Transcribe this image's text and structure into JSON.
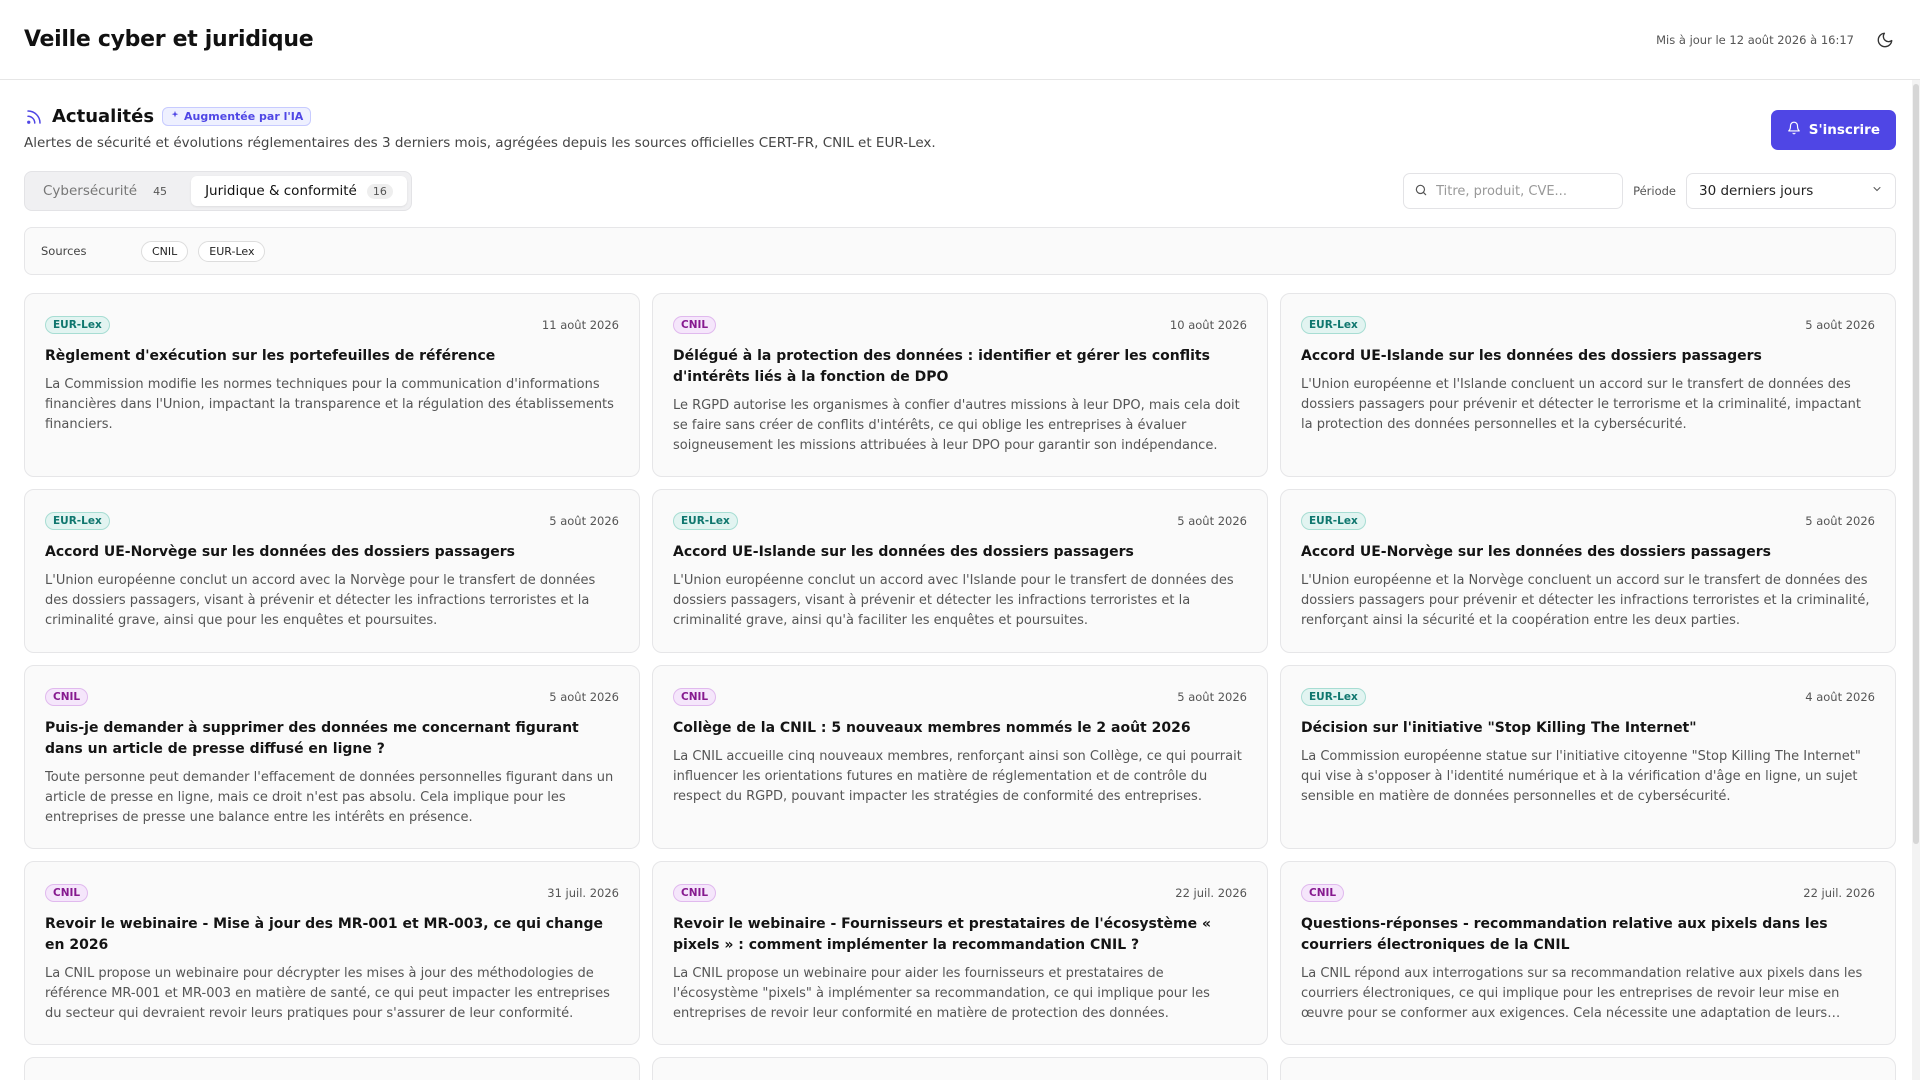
{
  "header": {
    "title": "Veille cyber et juridique",
    "updated": "Mis à jour le 12 août 2026 à 16:17",
    "theme_icon": "moon-icon"
  },
  "section": {
    "title": "Actualités",
    "ai_badge": "Augmentée par l'IA",
    "subtitle": "Alertes de sécurité et évolutions réglementaires des 3 derniers mois, agrégées depuis les sources officielles CERT-FR, CNIL et EUR-Lex.",
    "subscribe_label": "S'inscrire"
  },
  "tabs": [
    {
      "label": "Cybersécurité",
      "count": "45",
      "active": false
    },
    {
      "label": "Juridique & conformité",
      "count": "16",
      "active": true
    }
  ],
  "search": {
    "placeholder": "Titre, produit, CVE..."
  },
  "period": {
    "label": "Période",
    "value": "30 derniers jours"
  },
  "sources": {
    "label": "Sources",
    "chips": [
      "CNIL",
      "EUR-Lex"
    ]
  },
  "colors": {
    "accent": "#4f46e5",
    "eurlex": "#0f766e",
    "cnil": "#86198f"
  },
  "cards": [
    {
      "source": "EUR-Lex",
      "date": "11 août 2026",
      "title": "Règlement d'exécution sur les portefeuilles de référence",
      "text": "La Commission modifie les normes techniques pour la communication d'informations financières dans l'Union, impactant la transparence et la régulation des établissements financiers."
    },
    {
      "source": "CNIL",
      "date": "10 août 2026",
      "title": "Délégué à la protection des données : identifier et gérer les conflits d'intérêts liés à la fonction de DPO",
      "text": "Le RGPD autorise les organismes à confier d'autres missions à leur DPO, mais cela doit se faire sans créer de conflits d'intérêts, ce qui oblige les entreprises à évaluer soigneusement les missions attribuées à leur DPO pour garantir son indépendance."
    },
    {
      "source": "EUR-Lex",
      "date": "5 août 2026",
      "title": "Accord UE-Islande sur les données des dossiers passagers",
      "text": "L'Union européenne et l'Islande concluent un accord sur le transfert de données des dossiers passagers pour prévenir et détecter le terrorisme et la criminalité, impactant la protection des données personnelles et la cybersécurité."
    },
    {
      "source": "EUR-Lex",
      "date": "5 août 2026",
      "title": "Accord UE-Norvège sur les données des dossiers passagers",
      "text": "L'Union européenne conclut un accord avec la Norvège pour le transfert de données des dossiers passagers, visant à prévenir et détecter les infractions terroristes et la criminalité grave, ainsi que pour les enquêtes et poursuites."
    },
    {
      "source": "EUR-Lex",
      "date": "5 août 2026",
      "title": "Accord UE-Islande sur les données des dossiers passagers",
      "text": "L'Union européenne conclut un accord avec l'Islande pour le transfert de données des dossiers passagers, visant à prévenir et détecter les infractions terroristes et la criminalité grave, ainsi qu'à faciliter les enquêtes et poursuites."
    },
    {
      "source": "EUR-Lex",
      "date": "5 août 2026",
      "title": "Accord UE-Norvège sur les données des dossiers passagers",
      "text": "L'Union européenne et la Norvège concluent un accord sur le transfert de données des dossiers passagers pour prévenir et détecter les infractions terroristes et la criminalité, renforçant ainsi la sécurité et la coopération entre les deux parties."
    },
    {
      "source": "CNIL",
      "date": "5 août 2026",
      "title": "Puis-je demander à supprimer des données me concernant figurant dans un article de presse diffusé en ligne ?",
      "text": "Toute personne peut demander l'effacement de données personnelles figurant dans un article de presse en ligne, mais ce droit n'est pas absolu. Cela implique pour les entreprises de presse une balance entre les intérêts en présence."
    },
    {
      "source": "CNIL",
      "date": "5 août 2026",
      "title": "Collège de la CNIL : 5 nouveaux membres nommés le 2 août 2026",
      "text": "La CNIL accueille cinq nouveaux membres, renforçant ainsi son Collège, ce qui pourrait influencer les orientations futures en matière de réglementation et de contrôle du respect du RGPD, pouvant impacter les stratégies de conformité des entreprises."
    },
    {
      "source": "EUR-Lex",
      "date": "4 août 2026",
      "title": "Décision sur l'initiative \"Stop Killing The Internet\"",
      "text": "La Commission européenne statue sur l'initiative citoyenne \"Stop Killing The Internet\" qui vise à s'opposer à l'identité numérique et à la vérification d'âge en ligne, un sujet sensible en matière de données personnelles et de cybersécurité."
    },
    {
      "source": "CNIL",
      "date": "31 juil. 2026",
      "title": "Revoir le webinaire - Mise à jour des MR-001 et MR-003, ce qui change en 2026",
      "text": "La CNIL propose un webinaire pour décrypter les mises à jour des méthodologies de référence MR-001 et MR-003 en matière de santé, ce qui peut impacter les entreprises du secteur qui devraient revoir leurs pratiques pour s'assurer de leur conformité."
    },
    {
      "source": "CNIL",
      "date": "22 juil. 2026",
      "title": "Revoir le webinaire - Fournisseurs et prestataires de l'écosystème « pixels » : comment implémenter la recommandation CNIL ?",
      "text": "La CNIL propose un webinaire pour aider les fournisseurs et prestataires de l'écosystème \"pixels\" à implémenter sa recommandation, ce qui implique pour les entreprises de revoir leur conformité en matière de protection des données."
    },
    {
      "source": "CNIL",
      "date": "22 juil. 2026",
      "title": "Questions-réponses - recommandation relative aux pixels dans les courriers électroniques de la CNIL",
      "text": "La CNIL répond aux interrogations sur sa recommandation relative aux pixels dans les courriers électroniques, ce qui implique pour les entreprises de revoir leur mise en œuvre pour se conformer aux exigences. Cela nécessite une adaptation de leurs pratiques."
    }
  ]
}
